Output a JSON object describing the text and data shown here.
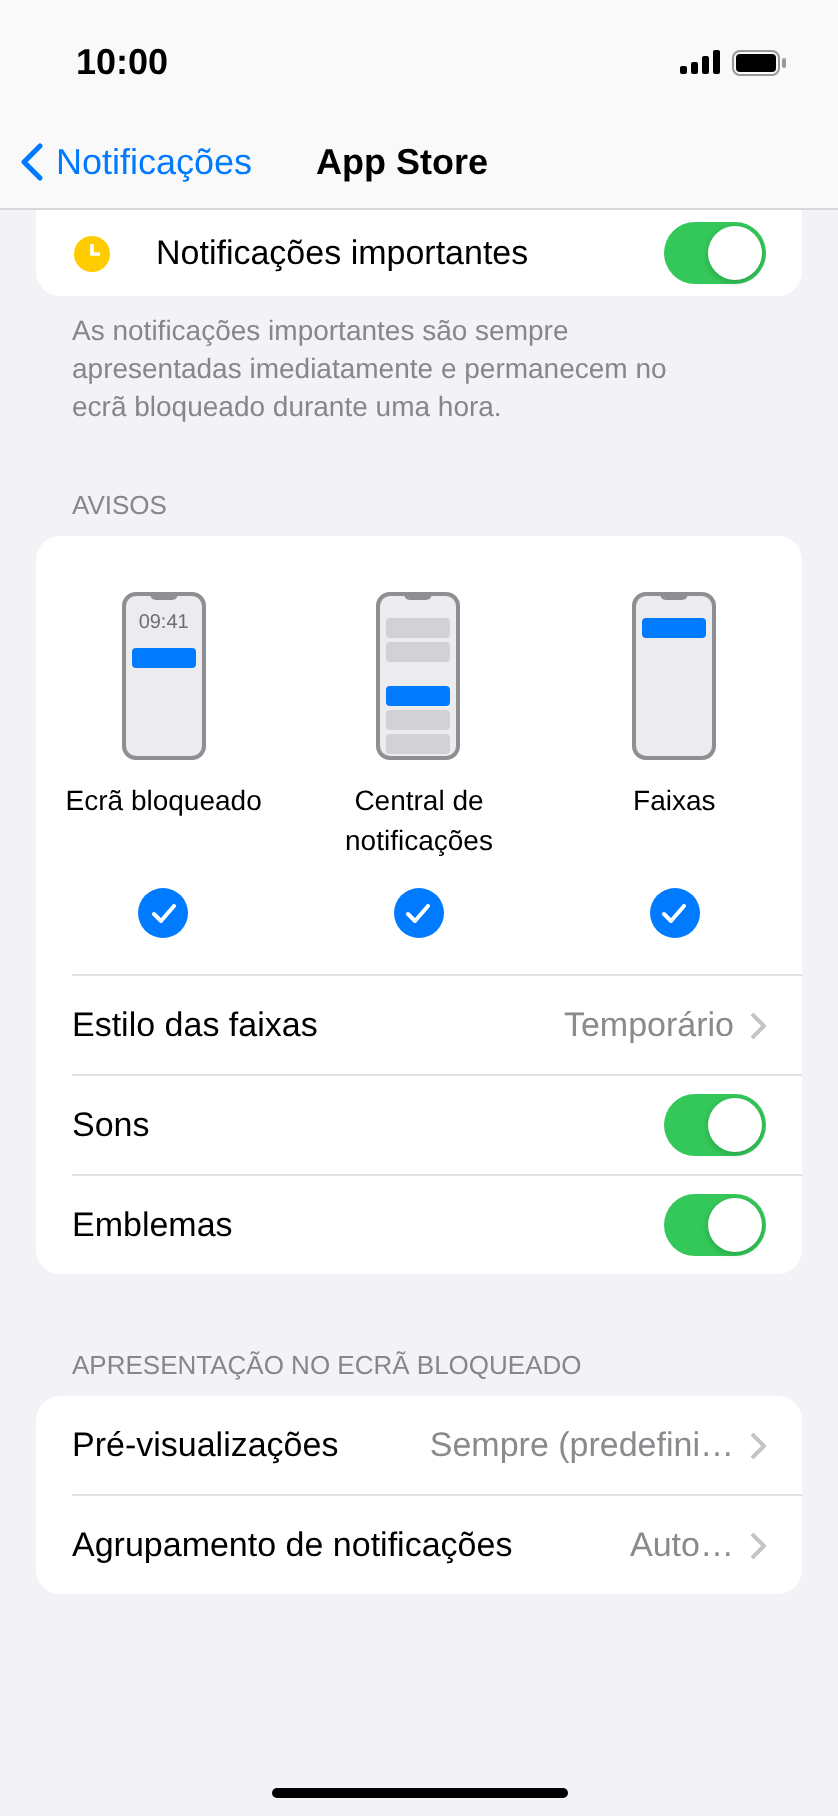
{
  "status_bar": {
    "time": "10:00"
  },
  "nav": {
    "back": "Notificações",
    "title": "App Store"
  },
  "important": {
    "label": "Notificações importantes",
    "on": true,
    "footer": "As notificações importantes são sempre apresentadas imediatamente e permanecem no ecrã bloqueado durante uma hora."
  },
  "alerts_section": {
    "header": "AVISOS",
    "styles": [
      {
        "kind": "lock",
        "time": "09:41",
        "label": "Ecrã bloqueado",
        "checked": true
      },
      {
        "kind": "center",
        "label": "Central de notificações",
        "checked": true
      },
      {
        "kind": "banner",
        "label": "Faixas",
        "checked": true
      }
    ],
    "rows": [
      {
        "kind": "link",
        "label": "Estilo das faixas",
        "value": "Temporário"
      },
      {
        "kind": "toggle",
        "label": "Sons",
        "on": true
      },
      {
        "kind": "toggle",
        "label": "Emblemas",
        "on": true
      }
    ]
  },
  "lock_section": {
    "header": "APRESENTAÇÃO NO ECRÃ BLOQUEADO",
    "rows": [
      {
        "kind": "link",
        "label": "Pré-visualizações",
        "value": "Sempre (predefini…"
      },
      {
        "kind": "link",
        "label": "Agrupamento de notificações",
        "value": "Auto…"
      }
    ]
  }
}
